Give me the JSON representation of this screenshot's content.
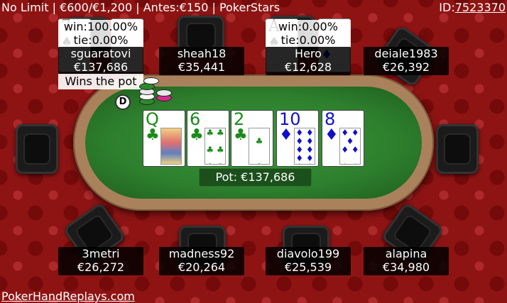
{
  "header": {
    "game_info": "No Limit | €600/€1,200 | Antes:€150 | PokerStars",
    "id_label": "ID:",
    "id_value": "7523370"
  },
  "footer": {
    "site_link": "PokerHandReplays.com"
  },
  "board": {
    "cards": [
      {
        "rank": "Q",
        "suit": "♣",
        "suit_name": "clubs"
      },
      {
        "rank": "6",
        "suit": "♣",
        "suit_name": "clubs"
      },
      {
        "rank": "2",
        "suit": "♣",
        "suit_name": "clubs"
      },
      {
        "rank": "10",
        "suit": "♦",
        "suit_name": "diamonds"
      },
      {
        "rank": "8",
        "suit": "♦",
        "suit_name": "diamonds"
      }
    ],
    "pot_label": "Pot: €137,686"
  },
  "dealer_button": "D",
  "players": {
    "sguaratovi": {
      "name": "sguaratovi",
      "stack": "€137,686",
      "win": "win:100.00%",
      "tie": "tie:0.00%",
      "result": "Wins the pot",
      "hole_cards": [
        {
          "rank": "7",
          "suit": "♠"
        },
        {
          "rank": "",
          "suit": ""
        }
      ]
    },
    "sheah18": {
      "name": "sheah18",
      "stack": "€35,441"
    },
    "hero": {
      "name": "Hero",
      "stack": "€12,628",
      "win": "win:0.00%",
      "tie": "tie:0.00%",
      "hole_cards": [
        {
          "rank": "A",
          "suit": "♠"
        },
        {
          "rank": "",
          "suit": "♦"
        }
      ]
    },
    "deiale1983": {
      "name": "deiale1983",
      "stack": "€26,392"
    },
    "3metri": {
      "name": "3metri",
      "stack": "€26,272"
    },
    "madness92": {
      "name": "madness92",
      "stack": "€20,264"
    },
    "diavolo199": {
      "name": "diavolo199",
      "stack": "€25,539"
    },
    "alapina": {
      "name": "alapina",
      "stack": "€34,980"
    }
  },
  "colors": {
    "background": "#8e1414",
    "felt": "#2d7f2d",
    "rail": "#a9825c",
    "clubs": "#1a8a1a",
    "diamonds": "#1010cc"
  }
}
